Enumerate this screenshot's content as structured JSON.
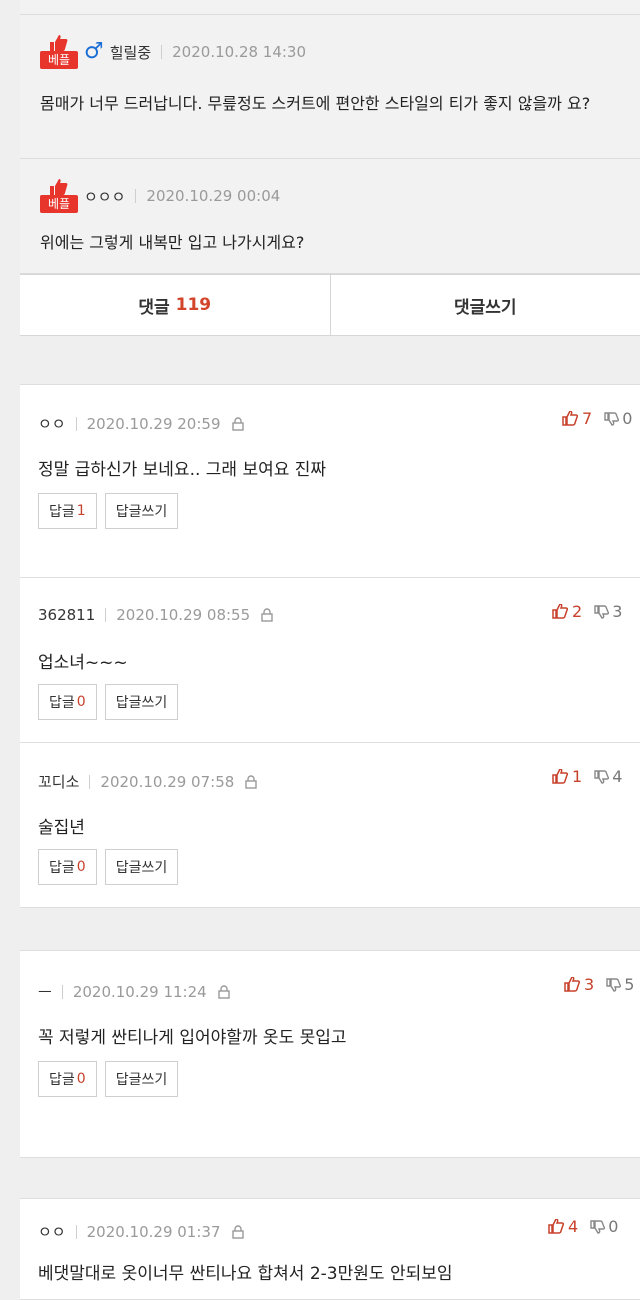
{
  "best_label": "베플",
  "best_comments": [
    {
      "nick": "힐릴중",
      "gender": "♂",
      "date": "2020.10.28 14:30",
      "text": "몸매가 너무 드러납니다. 무릎정도 스커트에 편안한 스타일의 티가 좋지 않을까 요?"
    },
    {
      "nick": "ㅇㅇㅇ",
      "date": "2020.10.29 00:04",
      "text": "위에는 그렇게 내복만 입고 나가시게요?"
    }
  ],
  "tabs": {
    "comments_label": "댓글",
    "comments_count": "119",
    "write_label": "댓글쓰기"
  },
  "reply_label": "답글",
  "reply_write_label": "답글쓰기",
  "comments": [
    {
      "nick": "ㅇㅇ",
      "date": "2020.10.29 20:59",
      "up": "7",
      "down": "0",
      "text": "정말 급하신가 보네요.. 그래 보여요 진짜",
      "replies": "1"
    },
    {
      "nick": "362811",
      "date": "2020.10.29 08:55",
      "up": "2",
      "down": "3",
      "text": "업소녀~~~",
      "replies": "0"
    },
    {
      "nick": "꼬디소",
      "date": "2020.10.29 07:58",
      "up": "1",
      "down": "4",
      "text": "술집년",
      "replies": "0"
    },
    {
      "nick": "ㅡ",
      "date": "2020.10.29 11:24",
      "up": "3",
      "down": "5",
      "text": "꼭 저렇게 싼티나게 입어야할까 옷도 못입고",
      "replies": "0"
    },
    {
      "nick": "ㅇㅇ",
      "date": "2020.10.29 01:37",
      "up": "4",
      "down": "0",
      "text": "베댓말대로 옷이너무 싼티나요 합쳐서 2-3만원도 안되보임"
    }
  ]
}
